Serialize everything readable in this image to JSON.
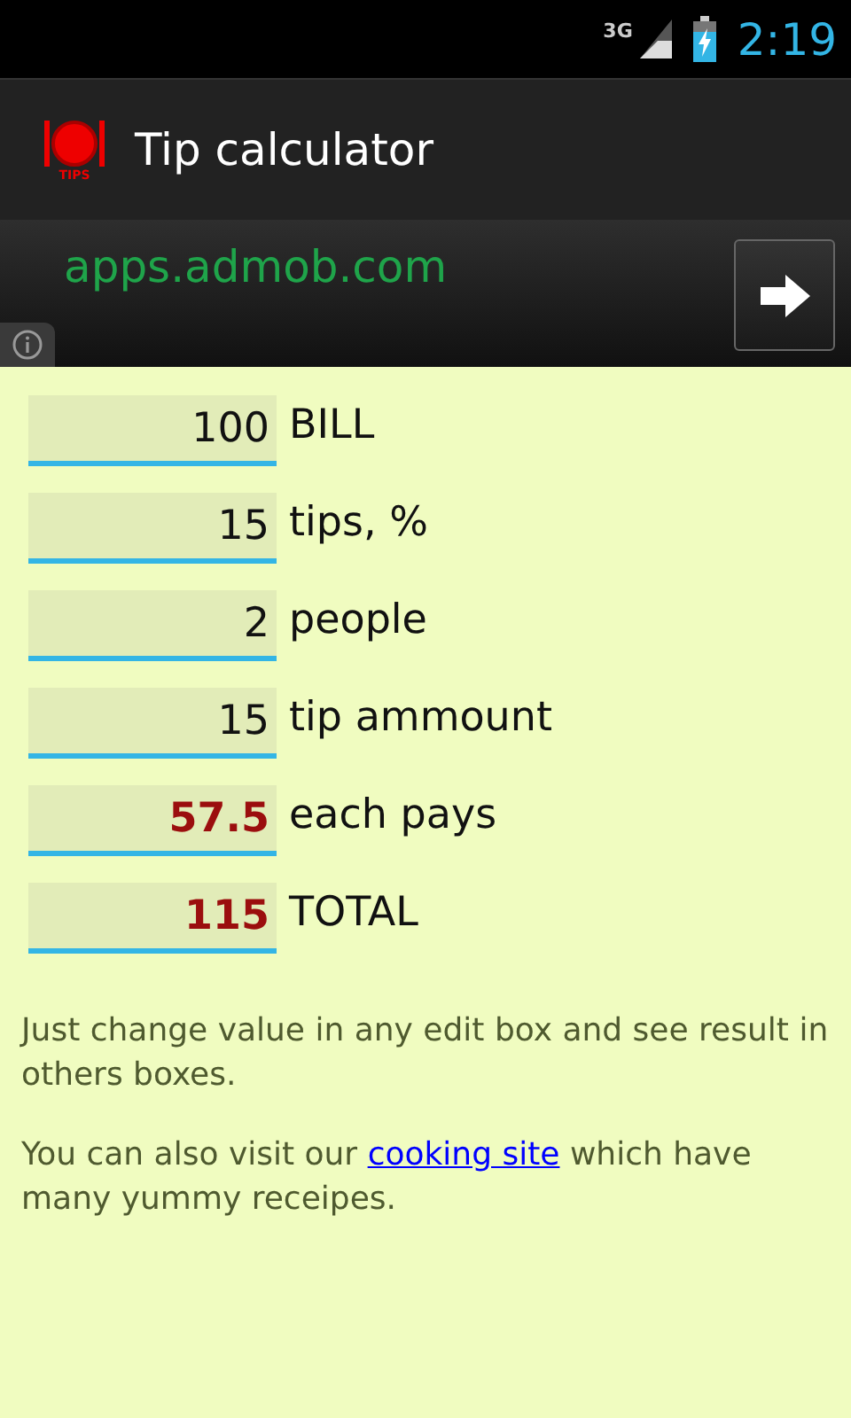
{
  "status_bar": {
    "network": "3G",
    "time": "2:19"
  },
  "action_bar": {
    "icon_text": "TIPS",
    "title": "Tip calculator"
  },
  "ad": {
    "text": "apps.admob.com"
  },
  "fields": [
    {
      "value": "100",
      "label": "BILL",
      "kind": "input"
    },
    {
      "value": "15",
      "label": "tips, %",
      "kind": "input"
    },
    {
      "value": "2",
      "label": "people",
      "kind": "input"
    },
    {
      "value": "15",
      "label": "tip ammount",
      "kind": "input"
    },
    {
      "value": "57.5",
      "label": "each pays",
      "kind": "result"
    },
    {
      "value": "115",
      "label": "TOTAL",
      "kind": "result"
    }
  ],
  "hint": "Just change value in any edit box and see result in others boxes.",
  "visit": {
    "before": "You can also visit our",
    "link": "cooking site",
    "after": "which have many yummy receipes."
  }
}
